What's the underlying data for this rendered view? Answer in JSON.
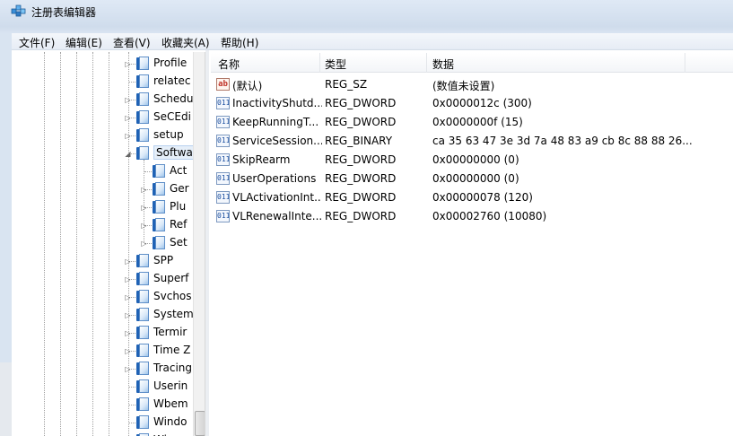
{
  "window": {
    "title": "注册表编辑器"
  },
  "menu": [
    "文件(F)",
    "编辑(E)",
    "查看(V)",
    "收藏夹(A)",
    "帮助(H)"
  ],
  "tree": {
    "items": [
      {
        "label": "Profile",
        "expandable": true,
        "level": 0
      },
      {
        "label": "relatec",
        "expandable": false,
        "level": 0
      },
      {
        "label": "Schedu",
        "expandable": true,
        "level": 0
      },
      {
        "label": "SeCEdi",
        "expandable": true,
        "level": 0
      },
      {
        "label": "setup",
        "expandable": true,
        "level": 0
      },
      {
        "label": "Softwa",
        "expandable": true,
        "expanded": true,
        "selected": true,
        "level": 0
      },
      {
        "label": "Act",
        "expandable": false,
        "level": 1
      },
      {
        "label": "Ger",
        "expandable": true,
        "level": 1
      },
      {
        "label": "Plu",
        "expandable": true,
        "level": 1
      },
      {
        "label": "Ref",
        "expandable": true,
        "level": 1
      },
      {
        "label": "Set",
        "expandable": true,
        "level": 1
      },
      {
        "label": "SPP",
        "expandable": true,
        "level": 0
      },
      {
        "label": "Superf",
        "expandable": true,
        "level": 0
      },
      {
        "label": "Svchos",
        "expandable": true,
        "level": 0
      },
      {
        "label": "System",
        "expandable": true,
        "level": 0
      },
      {
        "label": "Termir",
        "expandable": true,
        "level": 0
      },
      {
        "label": "Time Z",
        "expandable": true,
        "level": 0
      },
      {
        "label": "Tracing",
        "expandable": true,
        "level": 0
      },
      {
        "label": "Userin",
        "expandable": false,
        "level": 0
      },
      {
        "label": "Wbem",
        "expandable": false,
        "level": 0
      },
      {
        "label": "Windo",
        "expandable": false,
        "level": 0
      },
      {
        "label": "Win",
        "expandable": true,
        "level": 0
      }
    ]
  },
  "values": {
    "headers": {
      "name": "名称",
      "type": "类型",
      "data": "数据"
    },
    "rows": [
      {
        "icon": "string-value-icon",
        "name": "(默认)",
        "type": "REG_SZ",
        "data": "(数值未设置)"
      },
      {
        "icon": "binary-value-icon",
        "name": "InactivityShutd...",
        "type": "REG_DWORD",
        "data": "0x0000012c (300)"
      },
      {
        "icon": "binary-value-icon",
        "name": "KeepRunningT...",
        "type": "REG_DWORD",
        "data": "0x0000000f (15)"
      },
      {
        "icon": "binary-value-icon",
        "name": "ServiceSession...",
        "type": "REG_BINARY",
        "data": "ca 35 63 47 3e 3d 7a 48 83 a9 cb 8c 88 88 26..."
      },
      {
        "icon": "binary-value-icon",
        "name": "SkipRearm",
        "type": "REG_DWORD",
        "data": "0x00000000 (0)"
      },
      {
        "icon": "binary-value-icon",
        "name": "UserOperations",
        "type": "REG_DWORD",
        "data": "0x00000000 (0)"
      },
      {
        "icon": "binary-value-icon",
        "name": "VLActivationInt...",
        "type": "REG_DWORD",
        "data": "0x00000078 (120)"
      },
      {
        "icon": "binary-value-icon",
        "name": "VLRenewalInte...",
        "type": "REG_DWORD",
        "data": "0x00002760 (10080)"
      }
    ]
  }
}
